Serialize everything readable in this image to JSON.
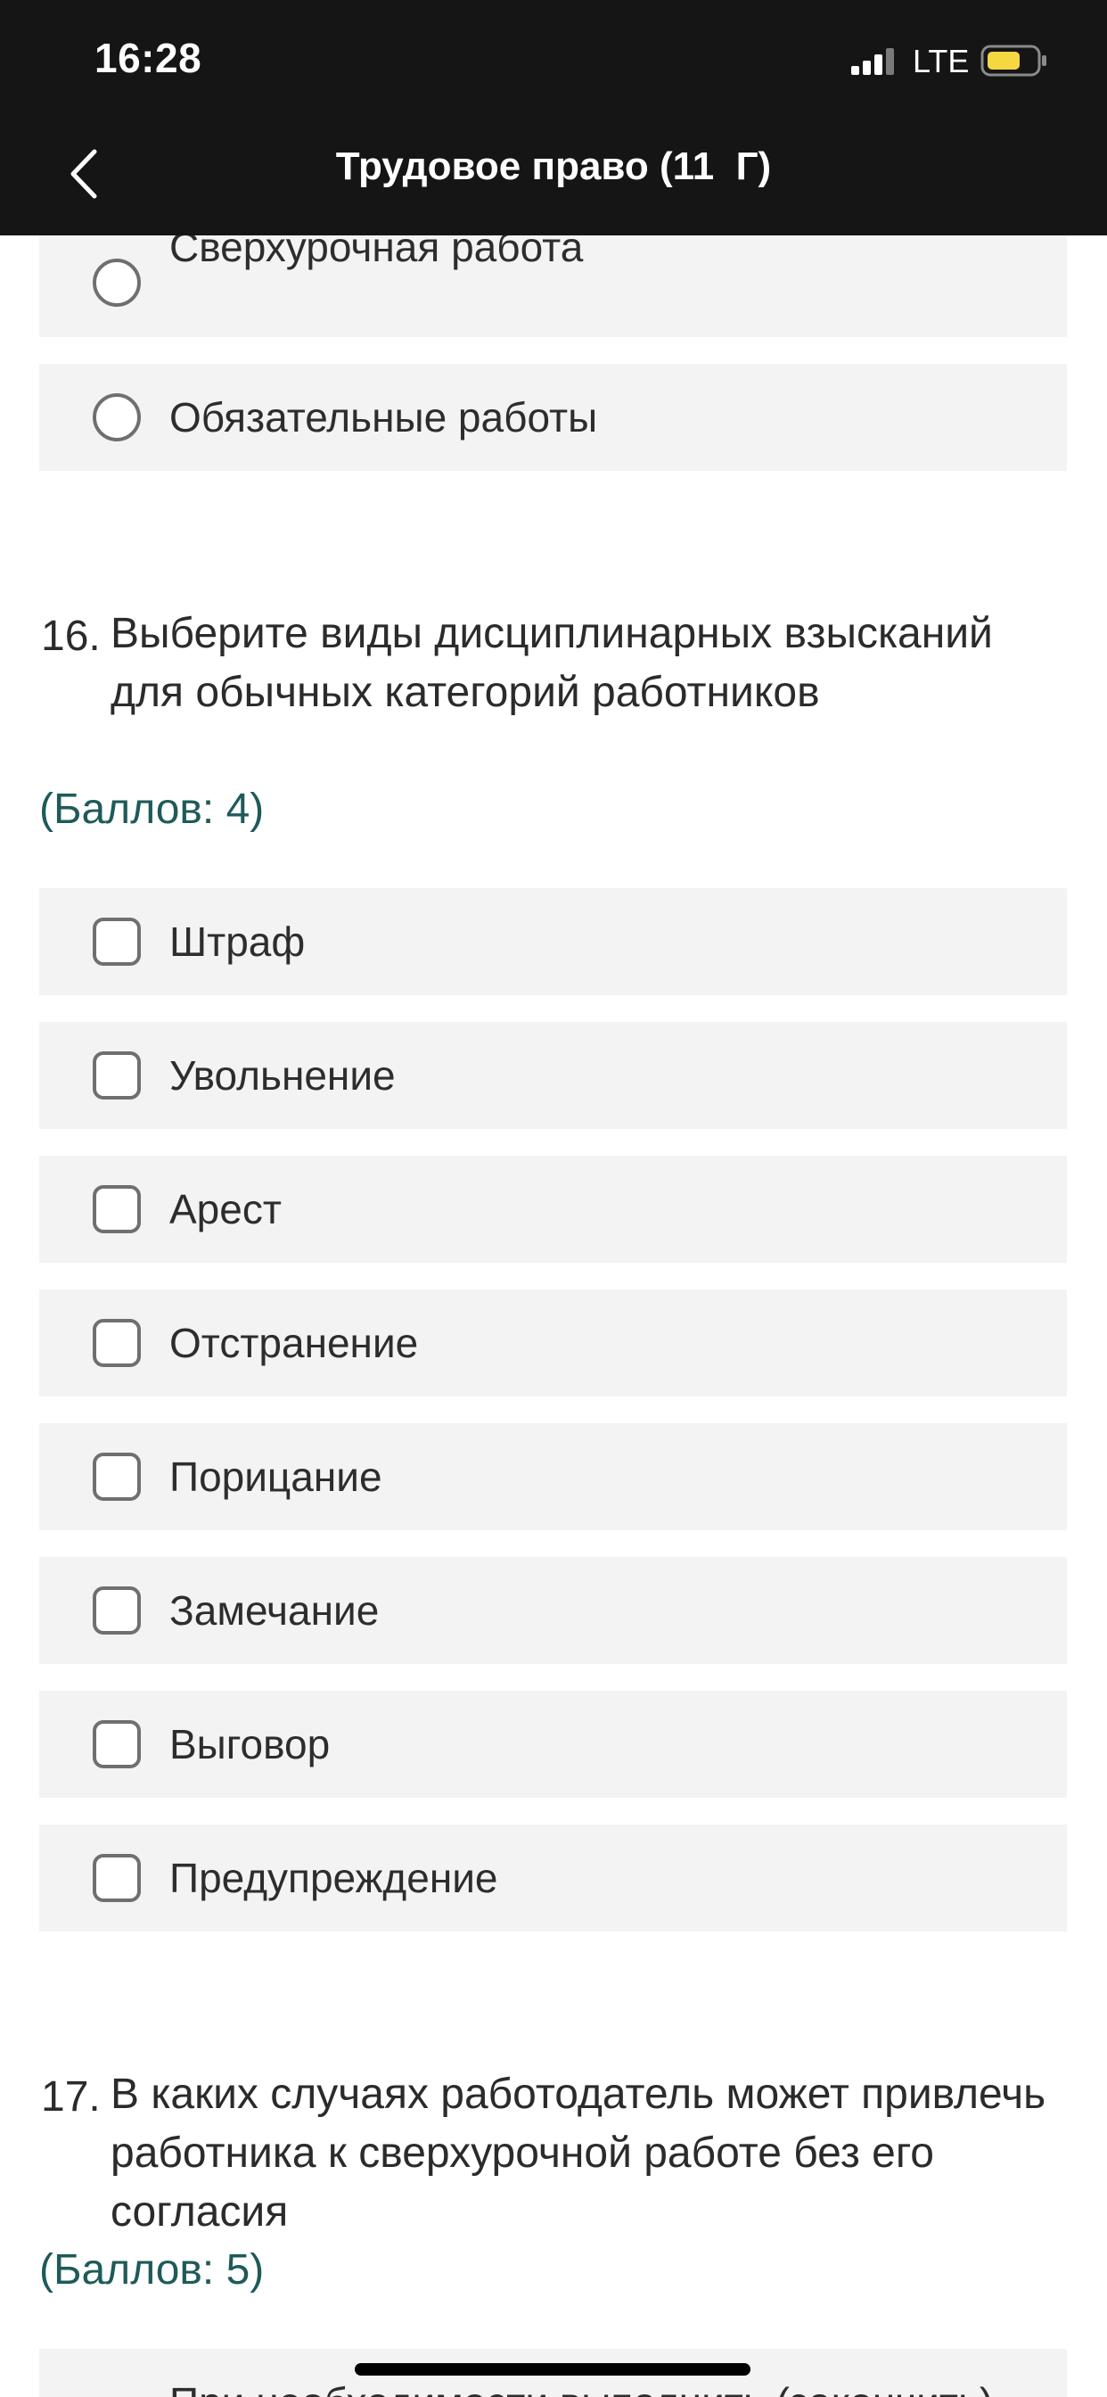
{
  "status_bar": {
    "time": "16:28",
    "network": "LTE",
    "signal_icon": "signal-bars-icon",
    "battery_icon": "battery-icon",
    "battery_color": "#f5d742"
  },
  "header": {
    "title": "Трудовое право (11  Г)",
    "back_icon": "chevron-left-icon"
  },
  "prev_question": {
    "options": [
      {
        "label": "Сверхурочная работа"
      },
      {
        "label": "Обязательные работы"
      }
    ]
  },
  "question_16": {
    "number": "16.",
    "text": "Выберите виды дисциплинарных взысканий для обычных категорий работников",
    "score": "(Баллов: 4)",
    "options": [
      {
        "label": "Штраф"
      },
      {
        "label": "Увольнение"
      },
      {
        "label": "Арест"
      },
      {
        "label": "Отстранение"
      },
      {
        "label": "Порицание"
      },
      {
        "label": "Замечание"
      },
      {
        "label": "Выговор"
      },
      {
        "label": "Предупреждение"
      }
    ]
  },
  "question_17": {
    "number": "17.",
    "text": "В каких случаях работодатель может привлечь работника к сверхурочной работе без его согласия",
    "score": "(Баллов: 5)",
    "options": [
      {
        "label": "При необходимости выполнить (закончить)"
      }
    ]
  },
  "colors": {
    "header_bg": "#151515",
    "option_bg": "#f3f3f3",
    "score_color": "#1f5a5a"
  }
}
